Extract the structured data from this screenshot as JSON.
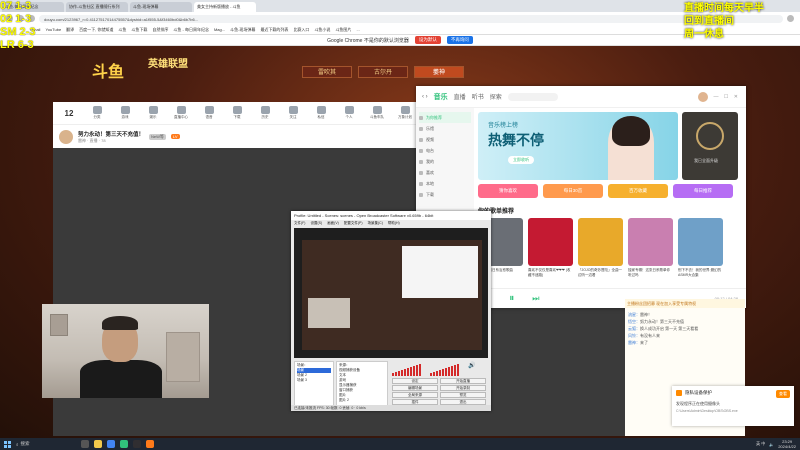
{
  "overlay": {
    "left_lines": [
      "07 1-3",
      "02 1-3",
      "SM 2-3",
      "LR 6-3"
    ],
    "right_lines": [
      "直播时间每天早半",
      "回到直播间",
      "周一休息"
    ]
  },
  "browser": {
    "tabs": [
      "斗鱼-每日周年纪念",
      "协作-斗鱼社区 直播随行系列",
      "斗鱼-现场弹幕",
      "美女主持新版播放 - 斗鱼"
    ],
    "url": "douyu.com/2123967_r=0.41127517014475557&dyshid=a1f555-5&f3460bd0&b6b7b6...",
    "bookmarks": [
      "Gmail",
      "YouTube",
      "翻译",
      "百度一下, 你就知道",
      "斗鱼",
      "斗鱼下载",
      "自然排序",
      "斗鱼 - 每日周年纪念",
      "Mag...",
      "斗鱼-现场弹幕",
      "最近下载的列表",
      "比赛入口",
      "斗鱼小说",
      "斗鱼图片",
      "..."
    ],
    "infobar_message": "Google Chrome 不是你的默认浏览器",
    "infobar_button": "设为默认",
    "infobar_dismiss": "不再询问"
  },
  "site": {
    "logo": "斗鱼",
    "game_logo": "英雄联盟",
    "hero_tabs": [
      "雷吹其",
      "古尔丹",
      "萎神"
    ],
    "toolbar_count": "12",
    "toolbar_items": [
      "分类",
      "游戏",
      "娱乐",
      "直播中心",
      "语音",
      "下载",
      "历史",
      "关注",
      "私信",
      "个人",
      "斗鱼车队",
      "万象计划",
      "主题",
      "五周大事",
      "斗鱼周刊",
      "斗鱼TV"
    ],
    "room_title": "努力永动！第三天不充值！",
    "room_sub": "雷神  ·  直播  ·  78",
    "room_tag1": "NeW等",
    "room_tag2": "LV"
  },
  "music": {
    "tabs": [
      "音乐",
      "直播",
      "听书",
      "探索"
    ],
    "sidebar": [
      "为你推荐",
      "乐馆",
      "视频",
      "电台",
      "我的",
      "喜欢",
      "本地",
      "下载"
    ],
    "banner_subtitle": "音乐榜上榜",
    "banner_title": "热舞不停",
    "banner_pill": "立即收听",
    "banner2_text": "我已全面升级",
    "categories": [
      "猜你喜欢",
      "每日30首",
      "百万收藏",
      "每日推荐",
      "云音乐"
    ],
    "category_colors": [
      "#ff6b8a",
      "#ff9a4d",
      "#f6b02e",
      "#b66df4",
      "#4aa3f0"
    ],
    "section_title": "你的歌单推荐",
    "covers": [
      {
        "caption": "超好听的日系治愈歌曲",
        "color": "#6a6e75"
      },
      {
        "caption": "喜欢不仅仅是喜欢❤❤❤ (收藏不迷路)",
        "color": "#c41a32"
      },
      {
        "caption": "「JOJO的奇妙冒险」全曲一边听一边看",
        "color": "#e8a92a"
      },
      {
        "caption": "独家专辑！这张日系歌单你听过吗",
        "color": "#c97fb0"
      },
      {
        "caption": "别下不去！我的世界·魔幻的ASMR大合集",
        "color": "#6fa0c8"
      }
    ],
    "time": "00:12 / 04:28"
  },
  "obs": {
    "title": "Profile: Untitled - Scenes: scenes - Open Broadcaster Software v0.659b - 64bit",
    "menu": [
      "文件(F)",
      "设置(S)",
      "画面(V)",
      "配置文件(P)",
      "场景集(C)",
      "帮助(H)"
    ],
    "scenes_label": "场景：",
    "scenes": [
      "场景",
      "场景 2",
      "场景 3"
    ],
    "sources_label": "来源：",
    "sources": [
      "视频捕获设备",
      "文本",
      "游戏",
      "显示器捕获",
      "窗口捕获",
      "图片",
      "图片 2",
      "图片 3"
    ],
    "buttons": [
      "设定",
      "开始直播",
      "编辑场景",
      "开始录制",
      "全局来源",
      "预览",
      "插件",
      "退出"
    ],
    "status": "已连接/未推流  FPS: 30  帧数: 0  丢帧: 0  ·  0 kb/s"
  },
  "chat": {
    "ad": "主播粉丝团招募  现在加入享受专属特权",
    "lines": [
      {
        "nick": "流星：",
        "text": "雷神！"
      },
      {
        "nick": "悟空：",
        "text": "努力永动！第三天不充值"
      },
      {
        "nick": "云狐：",
        "text": "换人成功开启 第一天 第三天看看"
      },
      {
        "nick": "风铃：",
        "text": "有没有人来"
      },
      {
        "nick": "雷神：",
        "text": "来了"
      }
    ]
  },
  "toast": {
    "title": "隐私设备保护",
    "body": "发现程序正在使用摄像头",
    "path": "C:\\Users\\Admin\\Desktop\\OBS\\OBS.exe",
    "button": "查看"
  },
  "taskbar": {
    "search": "搜索",
    "tray": "英  中",
    "time": "23:29",
    "date": "2024/4/22"
  }
}
